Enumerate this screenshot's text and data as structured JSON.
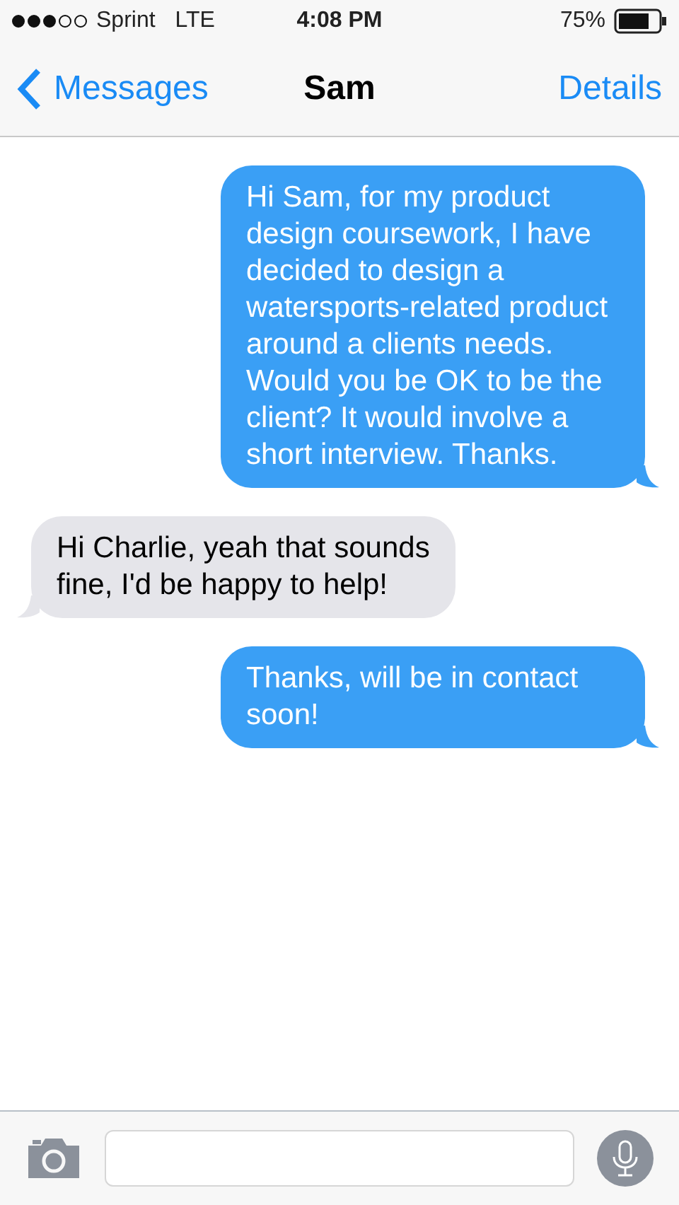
{
  "status_bar": {
    "carrier": "Sprint",
    "network": "LTE",
    "time": "4:08 PM",
    "battery": "75%"
  },
  "nav": {
    "back": "Messages",
    "title": "Sam",
    "action": "Details"
  },
  "messages": [
    {
      "kind": "sent",
      "text": "Hi Sam, for my product design coursework, I have decided to design a watersports-related product around a clients needs. Would you be OK to be the client? It would involve a short interview. Thanks."
    },
    {
      "kind": "received",
      "text": "Hi Charlie, yeah that sounds fine, I'd be happy to help!"
    },
    {
      "kind": "sent",
      "text": "Thanks, will be in contact soon!"
    }
  ]
}
